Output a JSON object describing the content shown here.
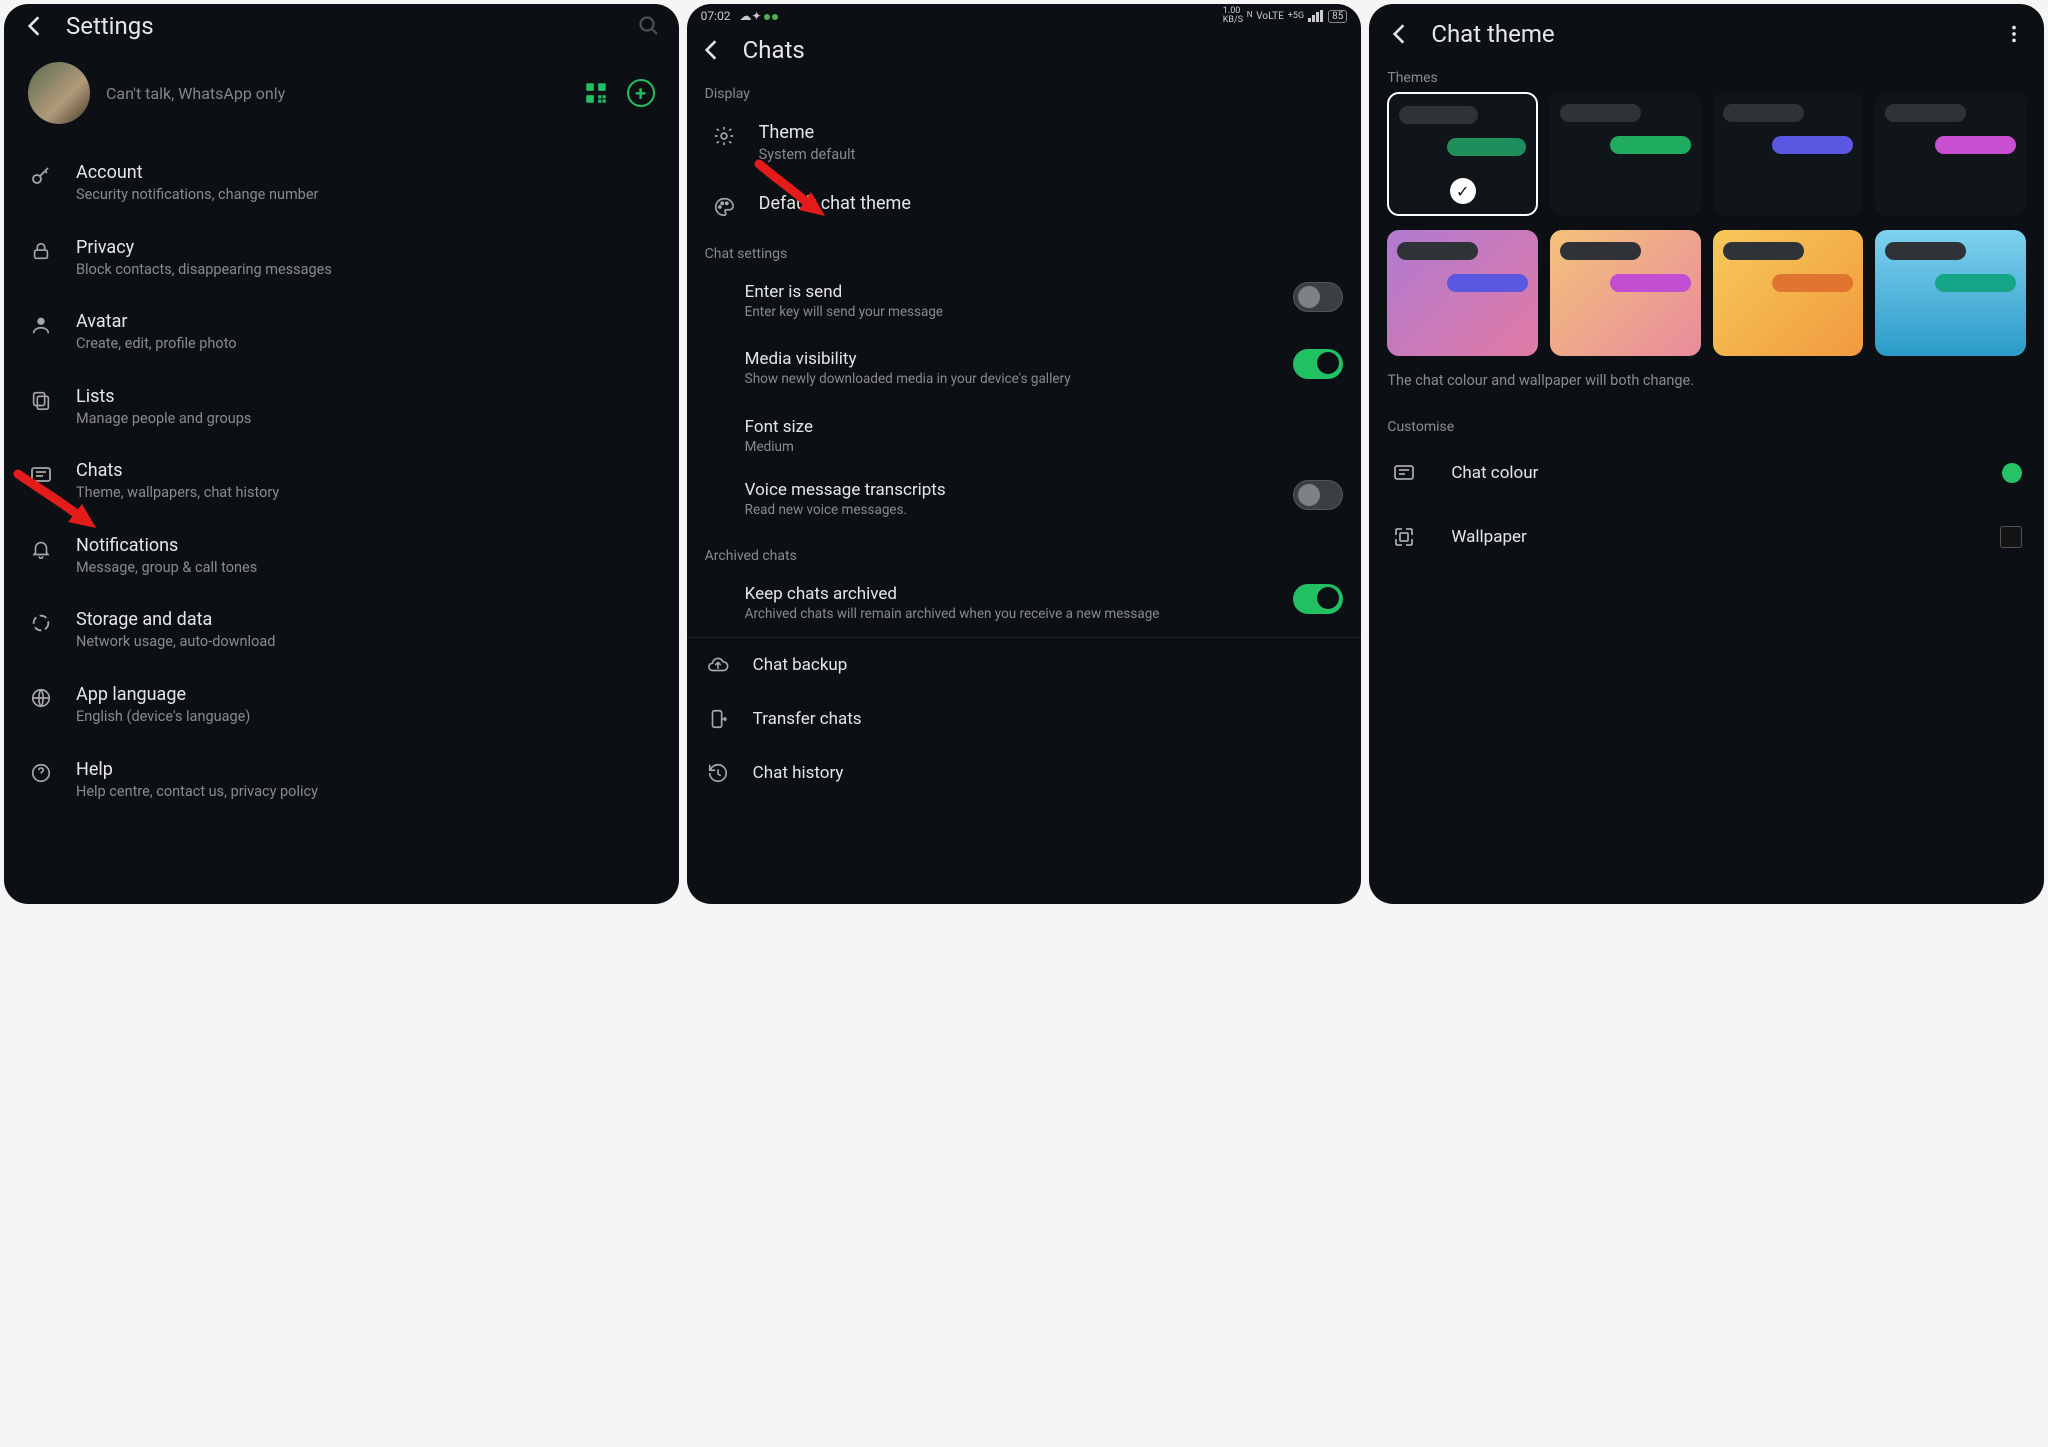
{
  "panel1": {
    "title": "Settings",
    "profile_status": "Can't talk, WhatsApp only",
    "items": [
      {
        "label": "Account",
        "sub": "Security notifications, change number",
        "icon": "key"
      },
      {
        "label": "Privacy",
        "sub": "Block contacts, disappearing messages",
        "icon": "lock"
      },
      {
        "label": "Avatar",
        "sub": "Create, edit, profile photo",
        "icon": "avatar"
      },
      {
        "label": "Lists",
        "sub": "Manage people and groups",
        "icon": "lists"
      },
      {
        "label": "Chats",
        "sub": "Theme, wallpapers, chat history",
        "icon": "chat"
      },
      {
        "label": "Notifications",
        "sub": "Message, group & call tones",
        "icon": "bell"
      },
      {
        "label": "Storage and data",
        "sub": "Network usage, auto-download",
        "icon": "data"
      },
      {
        "label": "App language",
        "sub": "English (device's language)",
        "icon": "globe"
      },
      {
        "label": "Help",
        "sub": "Help centre, contact us, privacy policy",
        "icon": "help"
      }
    ]
  },
  "panel2": {
    "time": "07:02",
    "battery": "85",
    "title": "Chats",
    "display_label": "Display",
    "theme": {
      "label": "Theme",
      "value": "System default"
    },
    "default_chat_theme": "Default chat theme",
    "chat_settings_label": "Chat settings",
    "enter_send": {
      "label": "Enter is send",
      "sub": "Enter key will send your message",
      "on": false
    },
    "media_vis": {
      "label": "Media visibility",
      "sub": "Show newly downloaded media in your device's gallery",
      "on": true
    },
    "font_size": {
      "label": "Font size",
      "value": "Medium"
    },
    "voice_trans": {
      "label": "Voice message transcripts",
      "sub": "Read new voice messages.",
      "on": false
    },
    "archived_label": "Archived chats",
    "keep_archived": {
      "label": "Keep chats archived",
      "sub": "Archived chats will remain archived when you receive a new message",
      "on": true
    },
    "chat_backup": "Chat backup",
    "transfer_chats": "Transfer chats",
    "chat_history": "Chat history"
  },
  "panel3": {
    "title": "Chat theme",
    "themes_label": "Themes",
    "hint": "The chat colour and wallpaper will both change.",
    "customise_label": "Customise",
    "chat_colour": "Chat colour",
    "wallpaper": "Wallpaper",
    "theme_colors_row1": [
      "#1e8f5c",
      "#1fab60",
      "#5a57e0",
      "#c84fcf"
    ],
    "theme_bg_row2": [
      "linear-gradient(135deg,#b07ad1,#e17aa4)",
      "linear-gradient(135deg,#f4c27a,#e88b9e)",
      "linear-gradient(135deg,#f7c95a,#f19a3e)",
      "linear-gradient(180deg,#7fd1ef,#2b9bc9)"
    ],
    "theme_bubble_row2": [
      "#5a57e0",
      "#c24fd1",
      "#e0752f",
      "#17a589"
    ]
  }
}
